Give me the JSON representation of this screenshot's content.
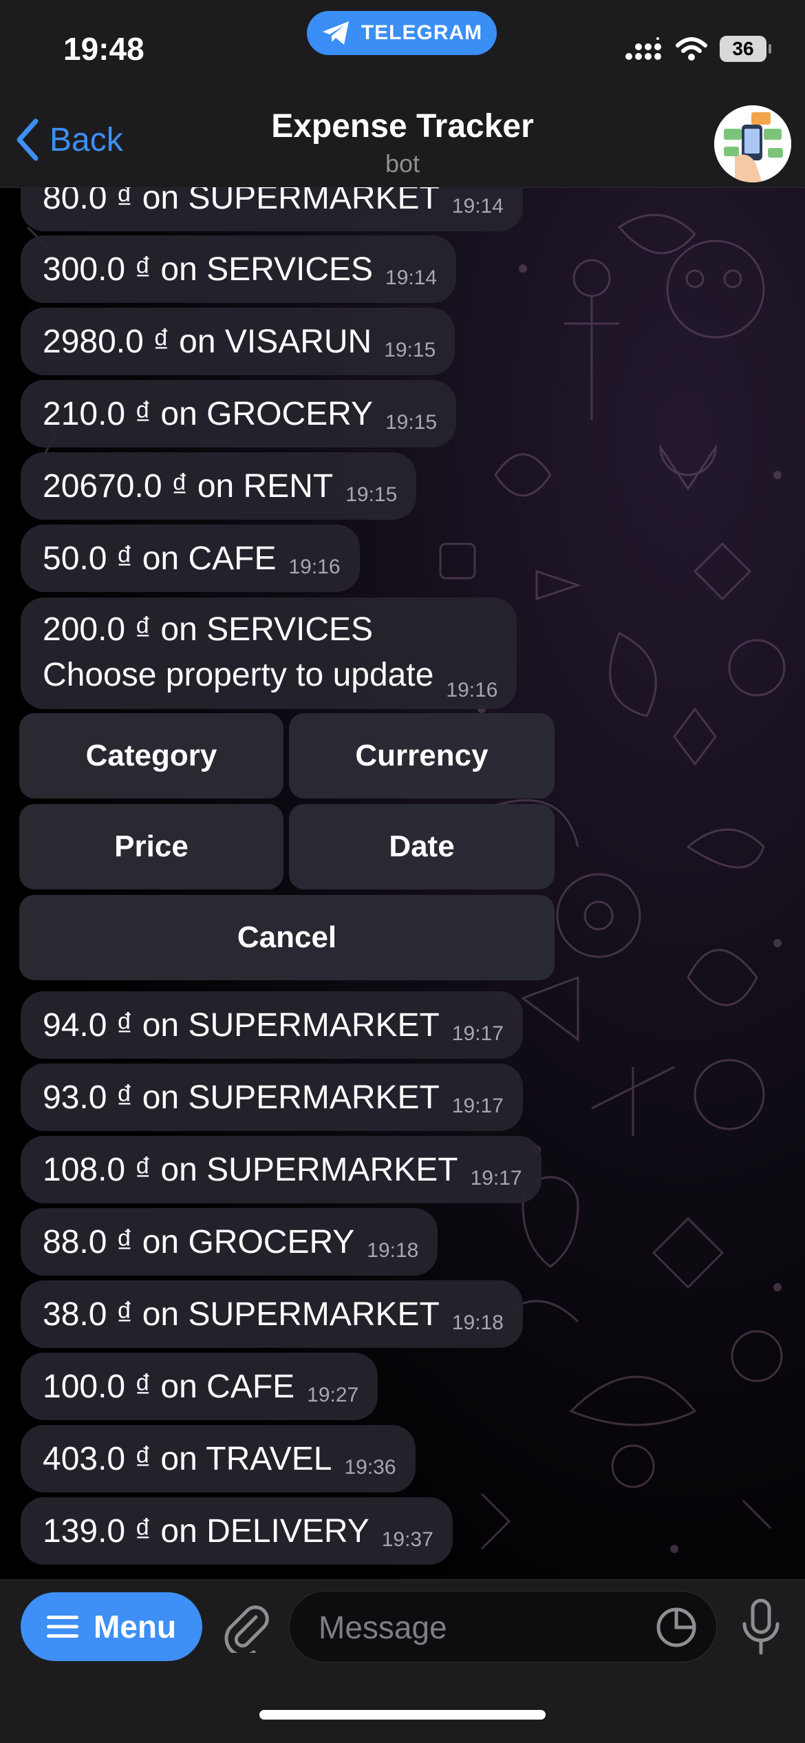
{
  "status_bar": {
    "time": "19:48",
    "app_pill": "TELEGRAM",
    "battery": "36"
  },
  "nav": {
    "back_label": "Back",
    "title": "Expense Tracker",
    "subtitle": "bot"
  },
  "messages_before": [
    {
      "text": "80.0 ₫ on SUPERMARKET",
      "time": "19:14"
    },
    {
      "text": "300.0 ₫ on SERVICES",
      "time": "19:14"
    },
    {
      "text": "2980.0 ₫ on VISARUN",
      "time": "19:15"
    },
    {
      "text": "210.0 ₫ on GROCERY",
      "time": "19:15"
    },
    {
      "text": "20670.0 ₫ on RENT",
      "time": "19:15"
    },
    {
      "text": "50.0 ₫ on CAFE",
      "time": "19:16"
    }
  ],
  "prompt_message": {
    "line1": "200.0 ₫ on SERVICES",
    "line2": "Choose property to update",
    "time": "19:16"
  },
  "inline_keyboard": {
    "category": "Category",
    "currency": "Currency",
    "price": "Price",
    "date": "Date",
    "cancel": "Cancel"
  },
  "messages_after": [
    {
      "text": "94.0 ₫ on SUPERMARKET",
      "time": "19:17"
    },
    {
      "text": "93.0 ₫ on SUPERMARKET",
      "time": "19:17"
    },
    {
      "text": "108.0 ₫ on SUPERMARKET",
      "time": "19:17"
    },
    {
      "text": "88.0 ₫ on GROCERY",
      "time": "19:18"
    },
    {
      "text": "38.0 ₫ on SUPERMARKET",
      "time": "19:18"
    },
    {
      "text": "100.0 ₫ on CAFE",
      "time": "19:27"
    },
    {
      "text": "403.0 ₫ on TRAVEL",
      "time": "19:36"
    },
    {
      "text": "139.0 ₫ on DELIVERY",
      "time": "19:37"
    }
  ],
  "input_bar": {
    "menu_label": "Menu",
    "message_placeholder": "Message"
  },
  "colors": {
    "accent": "#3e8ff6",
    "bubble": "#26242e",
    "bar": "#1c1c1e"
  },
  "icons": [
    "telegram-plane-icon",
    "signal-icon",
    "wifi-icon",
    "battery-icon",
    "back-chevron-icon",
    "menu-lines-icon",
    "paperclip-icon",
    "sticker-icon",
    "microphone-icon"
  ]
}
